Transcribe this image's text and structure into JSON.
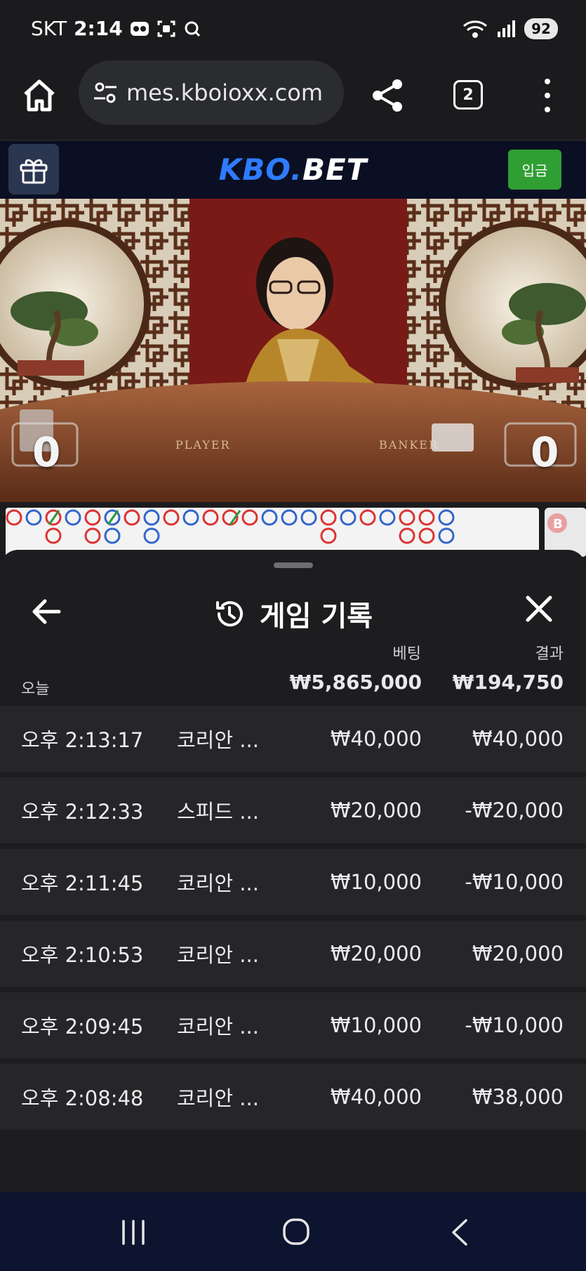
{
  "status_bar": {
    "carrier": "SKT",
    "time": "2:14",
    "battery": "92"
  },
  "browser": {
    "url": "mes.kboioxx.com",
    "tab_count": "2"
  },
  "site": {
    "logo_part1": "KBO",
    "logo_dot": ".",
    "logo_part2": "BET",
    "deposit_label": "입금",
    "accent_color": "#2f7bff",
    "deposit_color": "#2f9e33"
  },
  "video": {
    "player_score": "0",
    "banker_score": "0"
  },
  "sheet": {
    "title": "게임 기록",
    "bet_header": "베팅",
    "result_header": "결과",
    "today_label": "오늘",
    "total_bet": "₩5,865,000",
    "total_result": "₩194,750",
    "rows": [
      {
        "time": "오후 2:13:17",
        "game": "코리안 ...",
        "bet": "₩40,000",
        "result": "₩40,000"
      },
      {
        "time": "오후 2:12:33",
        "game": "스피드 ...",
        "bet": "₩20,000",
        "result": "-₩20,000"
      },
      {
        "time": "오후 2:11:45",
        "game": "코리안 ...",
        "bet": "₩10,000",
        "result": "-₩10,000"
      },
      {
        "time": "오후 2:10:53",
        "game": "코리안 ...",
        "bet": "₩20,000",
        "result": "₩20,000"
      },
      {
        "time": "오후 2:09:45",
        "game": "코리안 ...",
        "bet": "₩10,000",
        "result": "-₩10,000"
      },
      {
        "time": "오후 2:08:48",
        "game": "코리안 ...",
        "bet": "₩40,000",
        "result": "₩38,000"
      }
    ]
  }
}
